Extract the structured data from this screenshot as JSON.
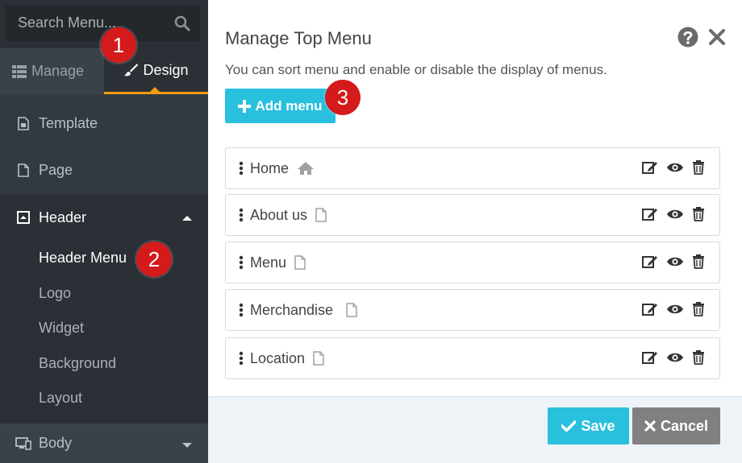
{
  "sidebar": {
    "search": {
      "placeholder": "Search Menu..."
    },
    "tabs": [
      {
        "label": "Manage",
        "icon": "list-icon"
      },
      {
        "label": "Design",
        "icon": "paintbrush-icon",
        "active": true
      }
    ],
    "items": [
      {
        "label": "Template",
        "icon": "template-icon"
      },
      {
        "label": "Page",
        "icon": "page-icon"
      },
      {
        "label": "Header",
        "icon": "header-icon",
        "expanded": true
      }
    ],
    "header_submenu": [
      {
        "label": "Header Menu",
        "active": true
      },
      {
        "label": "Logo"
      },
      {
        "label": "Widget"
      },
      {
        "label": "Background"
      },
      {
        "label": "Layout"
      }
    ],
    "body_item": {
      "label": "Body",
      "icon": "desktop-icon"
    }
  },
  "badges": [
    "1",
    "2",
    "3"
  ],
  "dialog": {
    "title": "Manage Top Menu",
    "description": "You can sort menu and enable or disable the display of menus.",
    "add_button": "Add menu",
    "menus": [
      {
        "label": "Home",
        "type_icon": "home-icon"
      },
      {
        "label": "About us",
        "type_icon": "page-icon"
      },
      {
        "label": "Menu",
        "type_icon": "page-icon"
      },
      {
        "label": "Merchandise",
        "type_icon": "page-icon"
      },
      {
        "label": "Location",
        "type_icon": "page-icon"
      }
    ],
    "save_label": "Save",
    "cancel_label": "Cancel"
  },
  "colors": {
    "sidebar_bg": "#323a41",
    "accent_orange": "#f39c12",
    "primary_button": "#29c0de",
    "cancel_button": "#808080",
    "badge_red": "#d41a1a"
  }
}
